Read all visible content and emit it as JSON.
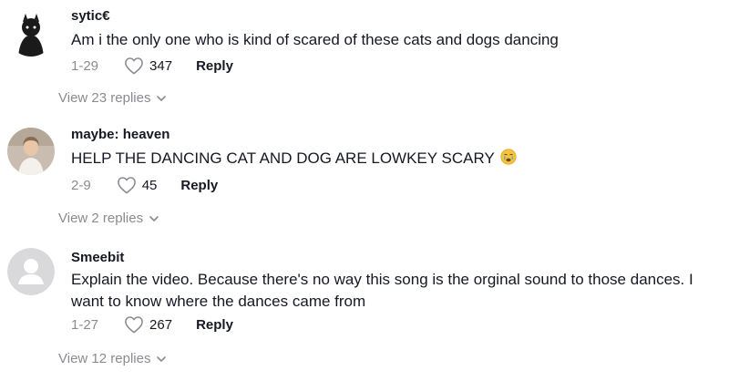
{
  "comments": [
    {
      "username": "sytic€",
      "text": "Am i the only one who is kind of scared of these cats and dogs dancing",
      "date": "1-29",
      "likes": "347",
      "reply_label": "Reply",
      "view_replies": "View 23 replies",
      "avatar": "dark-figure-avatar"
    },
    {
      "username": "maybe: heaven",
      "text": "HELP THE DANCING CAT AND DOG ARE LOWKEY SCARY",
      "emoji": "crying-face-emoji",
      "date": "2-9",
      "likes": "45",
      "reply_label": "Reply",
      "view_replies": "View 2 replies",
      "avatar": "photo-avatar"
    },
    {
      "username": "Smeebit",
      "text": "Explain the video. Because there's no way this song is the orginal sound to those dances. I want to know where the dances came from",
      "date": "1-27",
      "likes": "267",
      "reply_label": "Reply",
      "view_replies": "View 12 replies",
      "avatar": "default-gray-avatar"
    }
  ],
  "colors": {
    "text": "#161823",
    "muted": "#8a8b91",
    "divider": "#e3e3e4"
  },
  "icons": {
    "like": "heart-outline-icon",
    "expand": "chevron-down-icon"
  }
}
